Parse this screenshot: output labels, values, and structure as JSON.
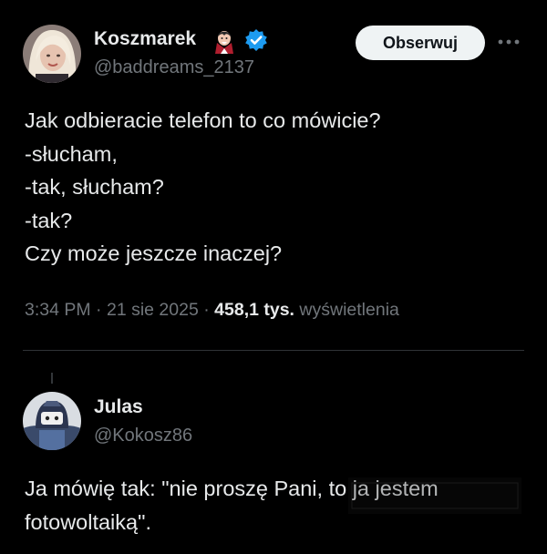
{
  "main_tweet": {
    "display_name": "Koszmarek",
    "handle": "@baddreams_2137",
    "follow_label": "Obserwuj",
    "lines": [
      "Jak odbieracie telefon to co mówicie?",
      "-słucham,",
      "-tak, słucham?",
      "-tak?",
      "Czy może jeszcze inaczej?"
    ],
    "time": "3:34 PM",
    "separator": "·",
    "date": "21 sie 2025",
    "views_count": "458,1 tys.",
    "views_label": "wyświetlenia",
    "icons": {
      "avatar": "avatar-photo",
      "emoji": "vampire-emoji-icon",
      "verified": "verified-badge-icon",
      "more": "more-icon"
    }
  },
  "reply": {
    "display_name": "Julas",
    "handle": "@Kokosz86",
    "lines": [
      "Ja mówię tak: \"nie proszę Pani, to ja jestem",
      "fotowoltaiką\"."
    ]
  },
  "colors": {
    "background": "#000000",
    "text_primary": "#e7e9ea",
    "text_secondary": "#71767b",
    "verified": "#1d9bf0",
    "button_bg": "#eff3f4",
    "divider": "#2f3336"
  }
}
